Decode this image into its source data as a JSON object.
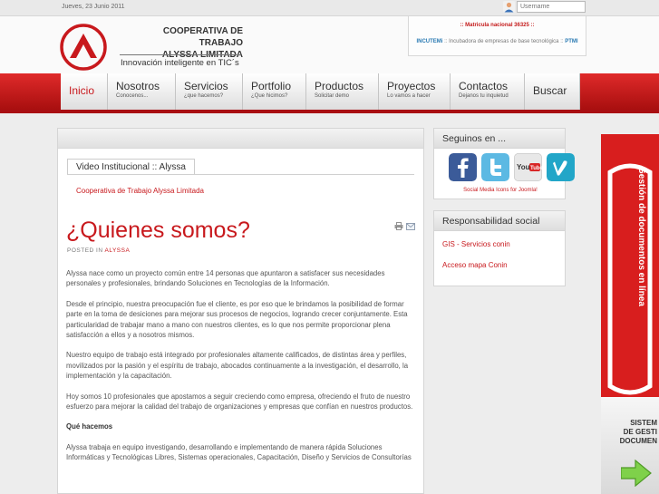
{
  "topbar": {
    "date": "Jueves, 23 Junio 2011",
    "username_placeholder": "Username"
  },
  "logo": {
    "title_line1": "COOPERATIVA DE TRABAJO",
    "title_line2": "ALYSSA LIMITADA",
    "tagline": "Innovación inteligente en TIC´s"
  },
  "infobox": {
    "line1_prefix": ":: ",
    "line1_label": "Matricula nacional 36325",
    "line1_suffix": " ::",
    "line2_left": "INCUTEMi",
    "line2_middle": " :: Incubadora de empresas de base tecnológica :: ",
    "line2_right": "PTMI"
  },
  "nav": {
    "items": [
      {
        "label": "Inicio",
        "sub": ""
      },
      {
        "label": "Nosotros",
        "sub": "Conocenos..."
      },
      {
        "label": "Servicios",
        "sub": "¿que hacemos?"
      },
      {
        "label": "Portfolio",
        "sub": "¿Que hicimos?"
      },
      {
        "label": "Productos",
        "sub": "Solicitar demo"
      },
      {
        "label": "Proyectos",
        "sub": "Lo vamos a hacer"
      },
      {
        "label": "Contactos",
        "sub": "Dejanos tu inquietud"
      },
      {
        "label": "Buscar",
        "sub": ""
      }
    ]
  },
  "main": {
    "video_tab": "Video Institucional :: Alyssa",
    "video_link": "Cooperativa de Trabajo Alyssa Limitada",
    "article_title": "¿Quienes somos?",
    "posted_label": "POSTED IN",
    "posted_author": "ALYSSA",
    "paragraphs": [
      "Alyssa nace como un proyecto común entre 14 personas que apuntaron a satisfacer sus necesidades personales y profesionales, brindando Soluciones en Tecnologías de la Información.",
      "Desde el principio, nuestra preocupación fue el cliente, es por eso que le brindamos la posibilidad de formar parte en la toma de desiciones para mejorar sus procesos de negocios, logrando crecer conjuntamente. Esta particularidad de trabajar mano a mano con nuestros clientes, es lo que nos permite proporcionar plena satisfacción a ellos y a nosotros mismos.",
      "Nuestro equipo de trabajo está integrado por profesionales altamente calificados, de distintas área y perfiles, movilizados por la pasión y el espíritu de trabajo, abocados continuamente a la investigación, el desarrollo, la implementación y la capacitación.",
      "Hoy somos 10 profesionales que apostamos a seguir creciendo como empresa, ofreciendo el fruto de nuestro esfuerzo para mejorar la calidad del trabajo de organizaciones y empresas que confían en nuestros productos."
    ],
    "heading_que_hacemos": "Qué hacemos",
    "paragraph_que_hacemos": "Alyssa trabaja en equipo investigando, desarrollando e implementando de manera rápida Soluciones Informáticas y Tecnológicas Libres, Sistemas operacionales, Capacitación, Diseño y Servicios de Consultorías"
  },
  "sidebar": {
    "social_title": "Seguinos en ...",
    "social_icons": [
      "facebook-icon",
      "twitter-icon",
      "youtube-icon",
      "vimeo-icon"
    ],
    "social_caption": "Social Media Icons for Joomla!",
    "responsabilidad_title": "Responsabilidad social",
    "links": [
      "GIS - Servicios conin",
      "Acceso mapa Conin"
    ]
  },
  "banner": {
    "vertical_text": "Gestión de documentos en línea",
    "grey_text_lines": [
      "SISTEM",
      "DE GESTI",
      "DOCUMEN"
    ]
  },
  "colors": {
    "brand_red": "#c8191d",
    "nav_red": "#d02020",
    "link_blue": "#2a7ab3"
  }
}
